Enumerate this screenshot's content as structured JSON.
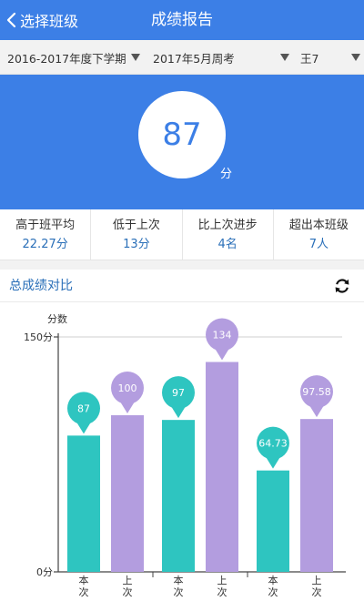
{
  "header": {
    "back_label": "选择班级",
    "title": "成绩报告"
  },
  "filters": {
    "term": "2016-2017年度下学期",
    "exam": "2017年5月周考",
    "student": "王7"
  },
  "score": {
    "value": "87",
    "unit": "分"
  },
  "stats": [
    {
      "label": "高于班平均",
      "value": "22.27分"
    },
    {
      "label": "低于上次",
      "value": "13分"
    },
    {
      "label": "比上次进步",
      "value": "4名"
    },
    {
      "label": "超出本班级",
      "value": "7人"
    }
  ],
  "chart_section": {
    "title": "总成绩对比"
  },
  "colors": {
    "header_blue": "#3c7fe6",
    "current_bar": "#2ec5c0",
    "previous_bar": "#b39ddf",
    "link_blue": "#2a6fb8"
  },
  "icons": {
    "back": "chevron-left-icon",
    "dropdown": "triangle-down-icon",
    "refresh": "refresh-icon"
  },
  "chart_data": {
    "type": "bar",
    "ylabel": "分数",
    "ylim": [
      0,
      150
    ],
    "y_ticks": [
      "0分",
      "150分"
    ],
    "categories": [
      "",
      "",
      ""
    ],
    "series_labels": [
      "本次",
      "上次"
    ],
    "series": [
      {
        "values": [
          87,
          97,
          64.73
        ],
        "color": "#2ec5c0"
      },
      {
        "values": [
          100,
          134,
          97.58
        ],
        "color": "#b39ddf"
      }
    ],
    "data_labels": [
      [
        "87",
        "97",
        "64.73"
      ],
      [
        "100",
        "134",
        "97.58"
      ]
    ],
    "grid": false
  }
}
